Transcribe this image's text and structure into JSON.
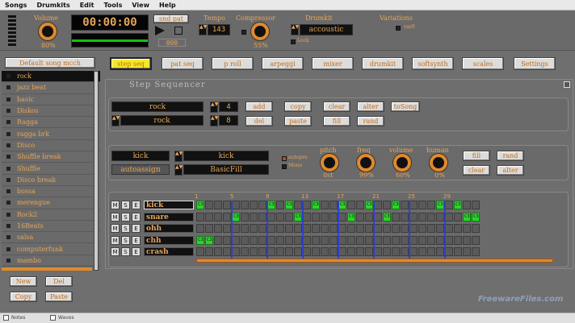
{
  "menu": [
    "Songs",
    "Drumkits",
    "Edit",
    "Tools",
    "View",
    "Help"
  ],
  "top": {
    "volume_label": "Volume",
    "volume_value": "80%",
    "time": "00:00:00",
    "snd_pat_label": "snd pat",
    "snd_pat_value": "000",
    "tempo_label": "Tempo",
    "tempo_value": "143",
    "compressor_label": "Compressor",
    "compressor_value": "55%",
    "drumkit_label": "Drumkit",
    "drumkit_value": "accoustic",
    "variations_label": "Variations",
    "var0": "var0",
    "lock_label": "Lock"
  },
  "sidebar": {
    "song_select": "Default song mcch",
    "songs": [
      "rock",
      "jazz beat",
      "basic",
      "Diskos",
      "Ragga",
      "ragga brk",
      "Disco",
      "Shuffle break",
      "Shuffle",
      "Disco break",
      "bossa",
      "merengue",
      "Rock2",
      "16Beats",
      "salsa",
      "computerfunk",
      "mambo"
    ],
    "selected_index": 0,
    "buttons": [
      "New",
      "Del",
      "Copy",
      "Paste"
    ]
  },
  "tabs": [
    "step seq",
    "pat seq",
    "p roll",
    "arpeggi",
    "mixer",
    "drumkit",
    "softsynth",
    "scales",
    "Settings"
  ],
  "active_tab": 0,
  "seq": {
    "title": "Step Sequencer",
    "pattern1": "rock",
    "pattern1_num": "4",
    "pattern2": "rock",
    "pattern2_num": "8",
    "buttons_row1": [
      "add",
      "copy",
      "clear",
      "alter",
      "toSong"
    ],
    "buttons_row2": [
      "del",
      "paste",
      "fill",
      "rand"
    ]
  },
  "inst": {
    "name": "kick",
    "assign": "autoassign",
    "sample": "kick",
    "fill": "BasicFill",
    "autopre": "autopre",
    "mono": "Mono",
    "pitch_label": "pitch",
    "pitch_value": "0st",
    "freq_label": "freq",
    "freq_value": "99%",
    "volume_label": "volume",
    "volume_value": "60%",
    "human_label": "human",
    "human_value": "0%",
    "buttons": [
      "fill",
      "rand",
      "clear",
      "alter"
    ]
  },
  "grid": {
    "ticks": [
      "1",
      "5",
      "9",
      "13",
      "17",
      "21",
      "25",
      "29"
    ],
    "tracks": [
      {
        "name": "kick",
        "m": "M",
        "s": "S",
        "e": "E",
        "steps": [
          1,
          0,
          0,
          0,
          0,
          0,
          0,
          0,
          1,
          0,
          1,
          0,
          0,
          1,
          0,
          0,
          1,
          0,
          0,
          1,
          0,
          0,
          1,
          0,
          0,
          0,
          0,
          1,
          0,
          1,
          0,
          0
        ]
      },
      {
        "name": "snare",
        "m": "M",
        "s": "S",
        "e": "E",
        "steps": [
          0,
          0,
          0,
          0,
          1,
          0,
          0,
          0,
          0,
          0,
          0,
          1,
          0,
          0,
          0,
          0,
          0,
          1,
          0,
          0,
          0,
          1,
          0,
          0,
          0,
          0,
          0,
          0,
          0,
          0,
          1,
          1
        ]
      },
      {
        "name": "ohh",
        "m": "M",
        "s": "S",
        "e": "E",
        "steps": [
          0,
          0,
          0,
          0,
          0,
          0,
          0,
          0,
          0,
          0,
          0,
          0,
          0,
          0,
          0,
          0,
          0,
          0,
          0,
          0,
          0,
          0,
          0,
          0,
          0,
          0,
          0,
          0,
          0,
          0,
          0,
          0
        ]
      },
      {
        "name": "chh",
        "m": "M",
        "s": "S",
        "e": "E",
        "steps": [
          1,
          1,
          0,
          0,
          0,
          0,
          0,
          0,
          0,
          0,
          0,
          0,
          0,
          0,
          0,
          0,
          0,
          0,
          0,
          0,
          0,
          0,
          0,
          0,
          0,
          0,
          0,
          0,
          0,
          0,
          0,
          0
        ]
      },
      {
        "name": "crash",
        "m": "M",
        "s": "S",
        "e": "E",
        "steps": [
          0,
          0,
          0,
          0,
          0,
          0,
          0,
          0,
          0,
          0,
          0,
          0,
          0,
          0,
          0,
          0,
          0,
          0,
          0,
          0,
          0,
          0,
          0,
          0,
          0,
          0,
          0,
          0,
          0,
          0,
          0,
          0
        ]
      }
    ],
    "cell_label": "C3"
  },
  "status": {
    "notes": "Notes",
    "waves": "Waves"
  },
  "watermark": "FreewareFiles.com",
  "colors": {
    "accent": "#e6a55a",
    "active_tab": "#f4e82a",
    "step_on": "#2fd12f",
    "bar_line": "#2d3fcf"
  }
}
